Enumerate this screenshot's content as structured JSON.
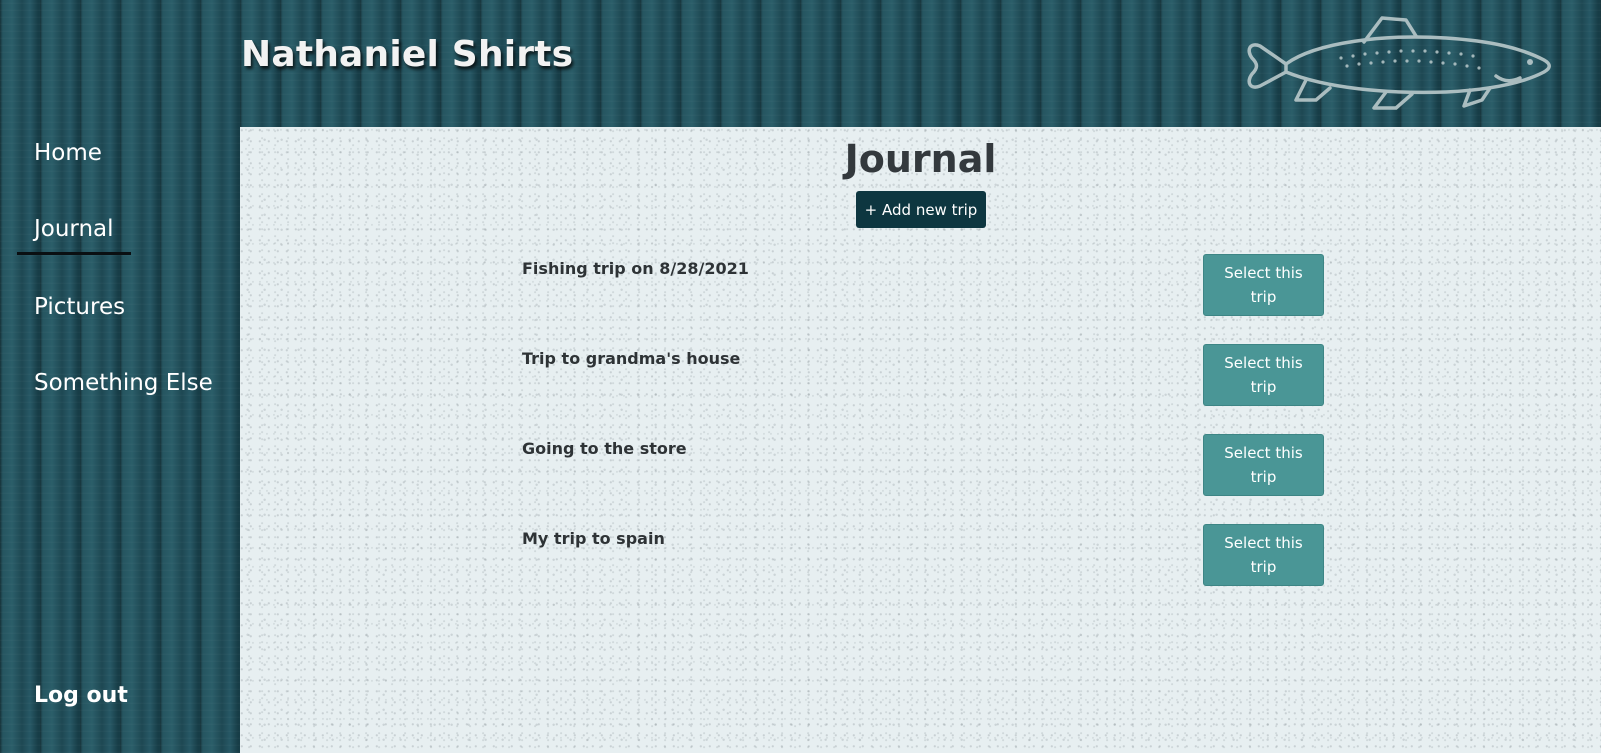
{
  "header": {
    "site_title": "Nathaniel Shirts",
    "logo_icon": "fish-icon"
  },
  "sidebar": {
    "items": [
      {
        "label": "Home",
        "active": false
      },
      {
        "label": "Journal",
        "active": true
      },
      {
        "label": "Pictures",
        "active": false
      },
      {
        "label": "Something Else",
        "active": false
      }
    ],
    "logout_label": "Log out"
  },
  "main": {
    "title": "Journal",
    "add_button_label": "+ Add new trip",
    "trips": [
      {
        "title": "Fishing trip on 8/28/2021",
        "button_label": "Select this trip"
      },
      {
        "title": "Trip to grandma's house",
        "button_label": "Select this trip"
      },
      {
        "title": "Going to the store",
        "button_label": "Select this trip"
      },
      {
        "title": "My trip to spain",
        "button_label": "Select this trip"
      }
    ]
  },
  "colors": {
    "accent_dark": "#0d3640",
    "select_button": "#4a9696",
    "panel_background": "#e7eff1",
    "wood": "#1f4a55"
  }
}
